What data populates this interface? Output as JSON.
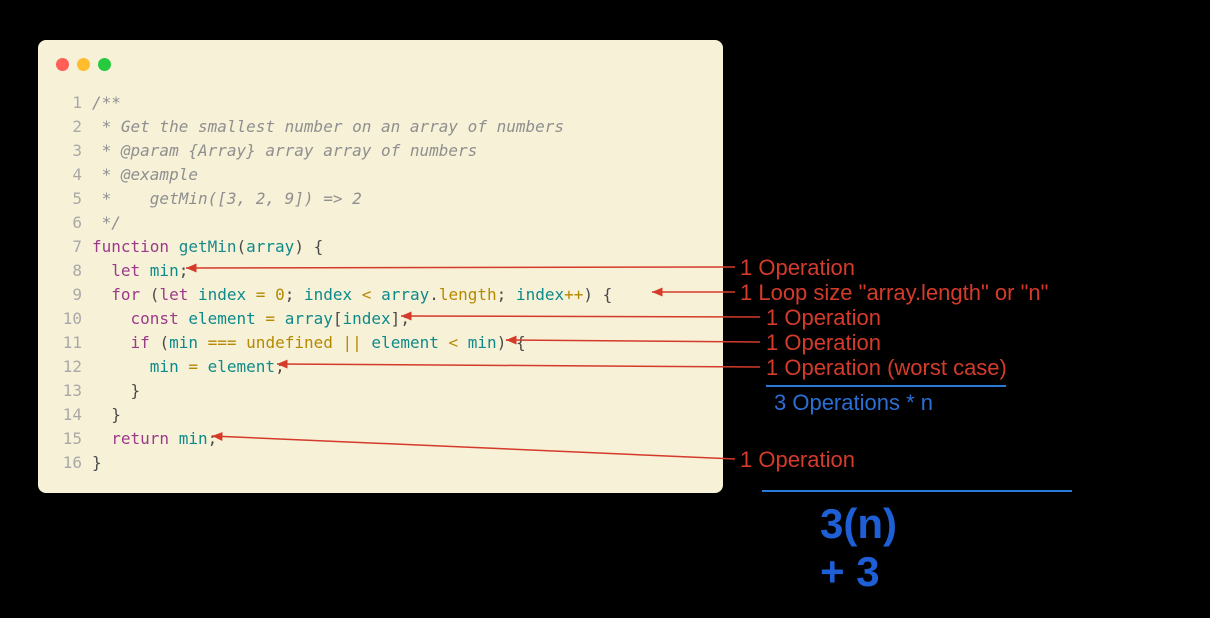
{
  "code": {
    "lines": [
      {
        "n": "1",
        "tokens": [
          [
            "c-comment",
            "/**"
          ]
        ]
      },
      {
        "n": "2",
        "tokens": [
          [
            "c-comment",
            " * Get the smallest number on an array of numbers"
          ]
        ]
      },
      {
        "n": "3",
        "tokens": [
          [
            "c-comment",
            " * @param {Array} array array of numbers"
          ]
        ]
      },
      {
        "n": "4",
        "tokens": [
          [
            "c-comment",
            " * @example"
          ]
        ]
      },
      {
        "n": "5",
        "tokens": [
          [
            "c-comment",
            " *    getMin([3, 2, 9]) => 2"
          ]
        ]
      },
      {
        "n": "6",
        "tokens": [
          [
            "c-comment",
            " */"
          ]
        ]
      },
      {
        "n": "7",
        "tokens": [
          [
            "c-keyword",
            "function "
          ],
          [
            "c-func",
            "getMin"
          ],
          [
            "c-brace",
            "("
          ],
          [
            "c-name",
            "array"
          ],
          [
            "c-brace",
            ")"
          ],
          [
            "c-plain",
            " "
          ],
          [
            "c-brace",
            "{"
          ]
        ]
      },
      {
        "n": "8",
        "tokens": [
          [
            "c-plain",
            "  "
          ],
          [
            "c-keyword",
            "let "
          ],
          [
            "c-name",
            "min"
          ],
          [
            "c-plain",
            ";"
          ]
        ]
      },
      {
        "n": "9",
        "tokens": [
          [
            "c-plain",
            "  "
          ],
          [
            "c-keyword",
            "for "
          ],
          [
            "c-brace",
            "("
          ],
          [
            "c-keyword",
            "let "
          ],
          [
            "c-name",
            "index"
          ],
          [
            "c-plain",
            " "
          ],
          [
            "c-op",
            "="
          ],
          [
            "c-plain",
            " "
          ],
          [
            "c-number",
            "0"
          ],
          [
            "c-plain",
            "; "
          ],
          [
            "c-name",
            "index"
          ],
          [
            "c-plain",
            " "
          ],
          [
            "c-op",
            "<"
          ],
          [
            "c-plain",
            " "
          ],
          [
            "c-name",
            "array"
          ],
          [
            "c-plain",
            "."
          ],
          [
            "c-prop",
            "length"
          ],
          [
            "c-plain",
            "; "
          ],
          [
            "c-name",
            "index"
          ],
          [
            "c-op",
            "++"
          ],
          [
            "c-brace",
            ")"
          ],
          [
            "c-plain",
            " "
          ],
          [
            "c-brace",
            "{"
          ]
        ]
      },
      {
        "n": "10",
        "tokens": [
          [
            "c-plain",
            "    "
          ],
          [
            "c-keyword",
            "const "
          ],
          [
            "c-name",
            "element"
          ],
          [
            "c-plain",
            " "
          ],
          [
            "c-op",
            "="
          ],
          [
            "c-plain",
            " "
          ],
          [
            "c-name",
            "array"
          ],
          [
            "c-brace",
            "["
          ],
          [
            "c-name",
            "index"
          ],
          [
            "c-brace",
            "]"
          ],
          [
            "c-plain",
            ";"
          ]
        ]
      },
      {
        "n": "11",
        "tokens": [
          [
            "c-plain",
            "    "
          ],
          [
            "c-keyword",
            "if "
          ],
          [
            "c-brace",
            "("
          ],
          [
            "c-name",
            "min"
          ],
          [
            "c-plain",
            " "
          ],
          [
            "c-op",
            "==="
          ],
          [
            "c-plain",
            " "
          ],
          [
            "c-undef",
            "undefined"
          ],
          [
            "c-plain",
            " "
          ],
          [
            "c-op",
            "||"
          ],
          [
            "c-plain",
            " "
          ],
          [
            "c-name",
            "element"
          ],
          [
            "c-plain",
            " "
          ],
          [
            "c-op",
            "<"
          ],
          [
            "c-plain",
            " "
          ],
          [
            "c-name",
            "min"
          ],
          [
            "c-brace",
            ")"
          ],
          [
            "c-plain",
            " "
          ],
          [
            "c-brace",
            "{"
          ]
        ]
      },
      {
        "n": "12",
        "tokens": [
          [
            "c-plain",
            "      "
          ],
          [
            "c-name",
            "min"
          ],
          [
            "c-plain",
            " "
          ],
          [
            "c-op",
            "="
          ],
          [
            "c-plain",
            " "
          ],
          [
            "c-name",
            "element"
          ],
          [
            "c-plain",
            ";"
          ]
        ]
      },
      {
        "n": "13",
        "tokens": [
          [
            "c-plain",
            "    "
          ],
          [
            "c-brace",
            "}"
          ]
        ]
      },
      {
        "n": "14",
        "tokens": [
          [
            "c-plain",
            "  "
          ],
          [
            "c-brace",
            "}"
          ]
        ]
      },
      {
        "n": "15",
        "tokens": [
          [
            "c-plain",
            "  "
          ],
          [
            "c-keyword",
            "return "
          ],
          [
            "c-name",
            "min"
          ],
          [
            "c-plain",
            ";"
          ]
        ]
      },
      {
        "n": "16",
        "tokens": [
          [
            "c-brace",
            "}"
          ]
        ]
      }
    ]
  },
  "annotations": {
    "a8": "1 Operation",
    "a9": "1 Loop size \"array.length\" or \"n\"",
    "a10": "1 Operation",
    "a11": "1 Operation",
    "a12": "1 Operation (worst case)",
    "sum_inner": "3 Operations * n",
    "a15": "1 Operation",
    "result": "3(n) + 3"
  }
}
